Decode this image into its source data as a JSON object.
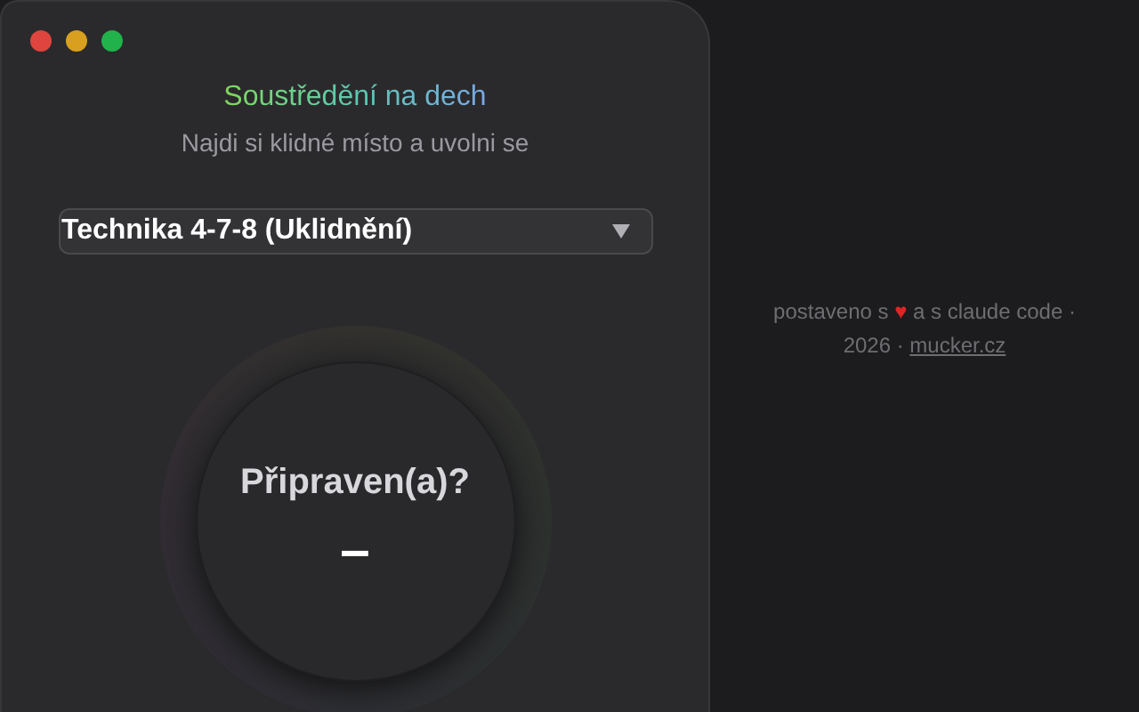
{
  "window": {
    "traffic_lights": [
      {
        "color": "#e0443e"
      },
      {
        "color": "#d9a020"
      },
      {
        "color": "#22b24c"
      }
    ]
  },
  "header": {
    "title": "Soustředění na dech",
    "subtitle": "Najdi si klidné místo a uvolni se"
  },
  "technique_select": {
    "value": "Technika 4-7-8 (Uklidnění)"
  },
  "breath_circle": {
    "prompt": "Připraven(a)?",
    "counter": "–"
  },
  "footer": {
    "text": "postaveno s **♥** a s claude code · 2026 ·",
    "link": "mucker.cz"
  }
}
